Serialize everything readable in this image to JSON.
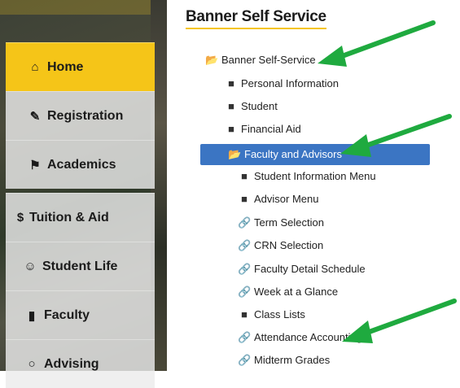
{
  "page_title": "Banner Self Service",
  "sidebar": {
    "items": [
      {
        "label": "Home",
        "icon": "home-icon",
        "glyph": "⌂",
        "active": true
      },
      {
        "label": "Registration",
        "icon": "edit-icon",
        "glyph": "✎"
      },
      {
        "label": "Academics",
        "icon": "graduation-cap-icon",
        "glyph": "⚑"
      },
      {
        "label": "Tuition & Aid",
        "icon": "dollar-icon",
        "glyph": "$"
      },
      {
        "label": "Student Life",
        "icon": "group-icon",
        "glyph": "☺"
      },
      {
        "label": "Faculty",
        "icon": "book-icon",
        "glyph": "▮"
      },
      {
        "label": "Advising",
        "icon": "chat-icon",
        "glyph": "○"
      }
    ]
  },
  "tree": {
    "root": "Banner Self-Service",
    "level1": [
      "Personal Information",
      "Student",
      "Financial Aid"
    ],
    "selected": "Faculty and Advisors",
    "children": [
      {
        "label": "Student Information Menu",
        "type": "folder"
      },
      {
        "label": "Advisor Menu",
        "type": "folder"
      },
      {
        "label": "Term Selection",
        "type": "link"
      },
      {
        "label": "CRN Selection",
        "type": "link"
      },
      {
        "label": "Faculty Detail Schedule",
        "type": "link"
      },
      {
        "label": "Week at a Glance",
        "type": "link"
      },
      {
        "label": "Class Lists",
        "type": "folder"
      },
      {
        "label": "Attendance Accounting",
        "type": "link"
      },
      {
        "label": "Midterm Grades",
        "type": "link"
      }
    ]
  },
  "colors": {
    "accent": "#f5c518",
    "selected": "#3b75c3",
    "arrow": "#1faa3f"
  }
}
